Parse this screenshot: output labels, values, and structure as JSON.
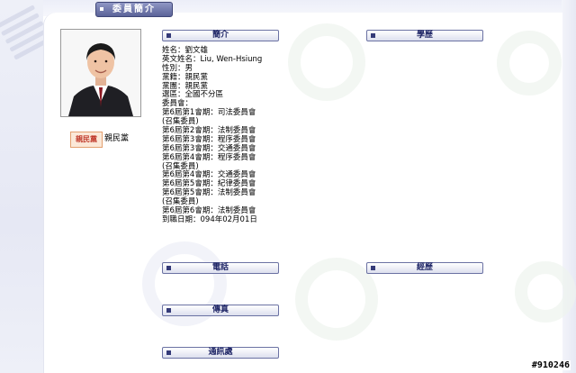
{
  "header": {
    "tab_title": "委員簡介"
  },
  "profile": {
    "party_logo_text": "親民黨",
    "party_label": "親民黨"
  },
  "sections": {
    "intro": "簡介",
    "education": "學歷",
    "phone": "電話",
    "experience": "經歷",
    "fax": "傳真",
    "address": "通訊處"
  },
  "info_lines": [
    "姓名：劉文雄",
    "英文姓名：Liu, Wen-Hsiung",
    "性別：男",
    "黨籍：親民黨",
    "黨團：親民黨",
    "選區：全國不分區",
    "委員會：",
    "第6屆第1會期：司法委員會",
    "(召集委員)",
    "第6屆第2會期：法制委員會",
    "第6屆第3會期：程序委員會",
    "第6屆第3會期：交通委員會",
    "第6屆第4會期：程序委員會",
    "(召集委員)",
    "第6屆第4會期：交通委員會",
    "第6屆第5會期：紀律委員會",
    "第6屆第5會期：法制委員會",
    "(召集委員)",
    "第6屆第6會期：法制委員會",
    "到職日期：094年02月01日"
  ],
  "watermark": "#910246",
  "colors": {
    "section_border": "#6b72a3",
    "section_text": "#1e2566",
    "tab_bg": "#5b6399"
  }
}
